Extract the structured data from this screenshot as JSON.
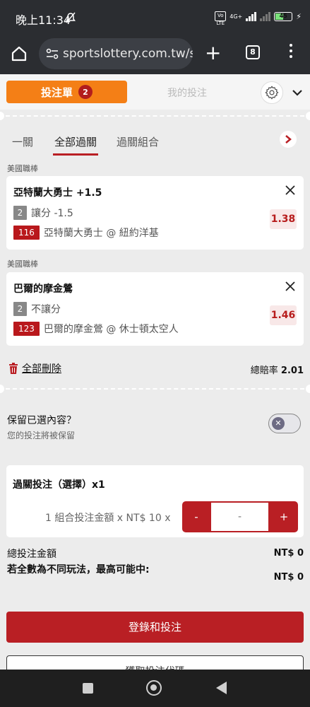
{
  "status_bar": {
    "time": "晚上11:34",
    "volte": "Vo LTE",
    "net": "4G+",
    "battery": "45"
  },
  "browser": {
    "url": "sportslottery.com.tw/s",
    "tab_count": "8"
  },
  "tabs": {
    "betslip_label": "投注單",
    "betslip_count": "2",
    "mybets_label": "我的投注"
  },
  "subtabs": [
    "一關",
    "全部過關",
    "過關組合"
  ],
  "bets": [
    {
      "league": "美國職棒",
      "team": "亞特蘭大勇士 +1.5",
      "market_no": "2",
      "market": "讓分 -1.5",
      "game_no": "116",
      "match": "亞特蘭大勇士 @ 紐約洋基",
      "odds": "1.38"
    },
    {
      "league": "美國職棒",
      "team": "巴爾的摩金鶯",
      "market_no": "2",
      "market": "不讓分",
      "game_no": "123",
      "match": "巴爾的摩金鶯 @ 休士頓太空人",
      "odds": "1.46"
    }
  ],
  "actions": {
    "clear_all": "全部刪除",
    "total_odds_label": "總賠率",
    "total_odds_value": "2.01"
  },
  "keep": {
    "title": "保留已選內容？",
    "subtitle": "您的投注將被保留",
    "enabled": false
  },
  "parlay": {
    "title": "過關投注（選擇）x1",
    "desc": "1 組合投注金額 x NT$ 10 x",
    "minus": "-",
    "amount": "-",
    "plus": "+"
  },
  "summary": {
    "total_label": "總投注金額",
    "total_value": "NT$ 0",
    "max_label": "若全數為不同玩法，最高可能中:",
    "max_value": "NT$ 0"
  },
  "buttons": {
    "login_bet": "登錄和投注",
    "promo": "獲取投注代碼"
  },
  "colors": {
    "accent_red": "#b91f24",
    "accent_orange": "#f47f16"
  }
}
